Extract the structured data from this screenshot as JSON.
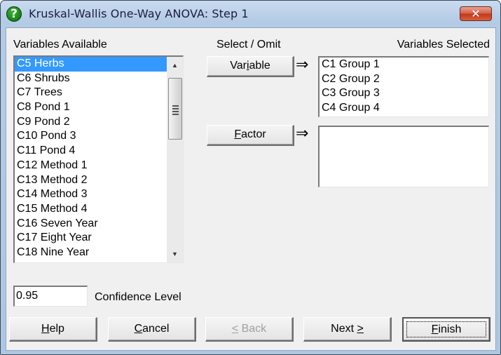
{
  "window": {
    "title": "Kruskal-Wallis One-Way ANOVA: Step 1",
    "icon": "question-icon",
    "close_glyph": "✕"
  },
  "labels": {
    "variables_available": "Variables Available",
    "select_omit": "Select / Omit",
    "variables_selected": "Variables Selected",
    "confidence_level": "Confidence Level"
  },
  "available_list": {
    "items": [
      "C5 Herbs",
      "C6 Shrubs",
      "C7 Trees",
      "C8 Pond 1",
      "C9 Pond 2",
      "C10 Pond 3",
      "C11 Pond 4",
      "C12 Method 1",
      "C13 Method 2",
      "C14 Method 3",
      "C15 Method 4",
      "C16 Seven Year",
      "C17 Eight Year",
      "C18 Nine Year"
    ],
    "selected_index": 0
  },
  "variable_button": {
    "pre": "Var",
    "accel": "i",
    "post": "able"
  },
  "factor_button": {
    "pre": "",
    "accel": "F",
    "post": "actor"
  },
  "arrow_glyph": "⇒",
  "selected_variables": {
    "items": [
      "C1 Group 1",
      "C2 Group 2",
      "C3 Group 3",
      "C4 Group 4"
    ]
  },
  "factor_list": {
    "items": []
  },
  "confidence": {
    "value": "0.95"
  },
  "buttons": {
    "help": {
      "pre": "",
      "accel": "H",
      "post": "elp"
    },
    "cancel": {
      "pre": "",
      "accel": "C",
      "post": "ancel"
    },
    "back": {
      "pre": "",
      "accel": "<",
      "post": " Back",
      "enabled": false
    },
    "next": {
      "pre": "Next ",
      "accel": ">",
      "post": ""
    },
    "finish": {
      "pre": "",
      "accel": "F",
      "post": "inish",
      "default": true
    }
  }
}
